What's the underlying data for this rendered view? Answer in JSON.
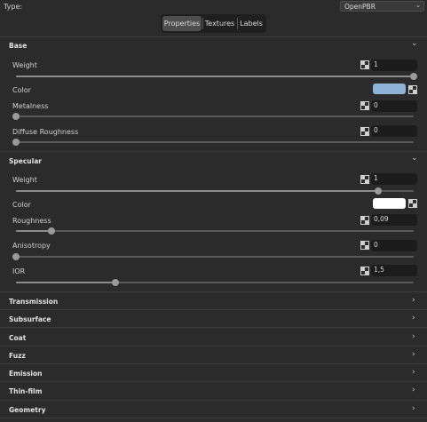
{
  "type_row": {
    "label": "Type:",
    "value": "OpenPBR"
  },
  "tabs": [
    {
      "label": "Properties",
      "active": true
    },
    {
      "label": "Textures",
      "active": false
    },
    {
      "label": "Labels",
      "active": false
    }
  ],
  "sections": {
    "base": {
      "title": "Base",
      "weight": {
        "label": "Weight",
        "value": "1",
        "fraction": 1.0
      },
      "color": {
        "label": "Color",
        "hex": "#8fb3d6"
      },
      "metalness": {
        "label": "Metalness",
        "value": "0",
        "fraction": 0.0
      },
      "diffuse_roughness": {
        "label": "Diffuse Roughness",
        "value": "0",
        "fraction": 0.0
      }
    },
    "specular": {
      "title": "Specular",
      "weight": {
        "label": "Weight",
        "value": "1",
        "fraction": 0.91
      },
      "color": {
        "label": "Color",
        "hex": "#ffffff"
      },
      "roughness": {
        "label": "Roughness",
        "value": "0,09",
        "fraction": 0.09
      },
      "anisotropy": {
        "label": "Anisotropy",
        "value": "0",
        "fraction": 0.0
      },
      "ior": {
        "label": "IOR",
        "value": "1,5",
        "fraction": 0.25
      }
    },
    "collapsed": [
      "Transmission",
      "Subsurface",
      "Coat",
      "Fuzz",
      "Emission",
      "Thin-film",
      "Geometry"
    ]
  },
  "colors": {
    "background": "#2b2b2b",
    "field": "#1c1c1c",
    "active_tab": "#4d4d4d"
  }
}
